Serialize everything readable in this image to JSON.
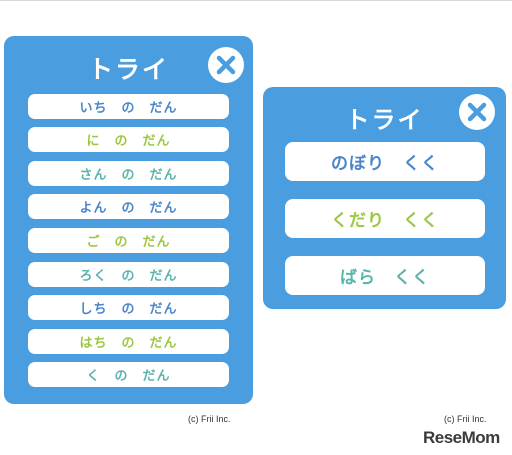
{
  "left_panel": {
    "title": "トライ",
    "buttons": [
      {
        "label": "いち　の　だん",
        "color": "#4a86c8"
      },
      {
        "label": "に　の　だん",
        "color": "#9cc741"
      },
      {
        "label": "さん　の　だん",
        "color": "#5ab4ad"
      },
      {
        "label": "よん　の　だん",
        "color": "#4a86c8"
      },
      {
        "label": "ご　の　だん",
        "color": "#9cc741"
      },
      {
        "label": "ろく　の　だん",
        "color": "#5ab4ad"
      },
      {
        "label": "しち　の　だん",
        "color": "#4a86c8"
      },
      {
        "label": "はち　の　だん",
        "color": "#9cc741"
      },
      {
        "label": "く　の　だん",
        "color": "#5ab4ad"
      }
    ],
    "copyright": "(c) Frii Inc."
  },
  "right_panel": {
    "title": "トライ",
    "buttons": [
      {
        "label": "のぼり　くく",
        "color": "#4a86c8"
      },
      {
        "label": "くだり　くく",
        "color": "#9cc741"
      },
      {
        "label": "ばら　くく",
        "color": "#5ab4ad"
      }
    ],
    "copyright": "(c) Frii Inc."
  },
  "colors": {
    "panel_bg": "#4a9ee0",
    "button_bg": "#ffffff",
    "close_icon": "#4a9ee0"
  },
  "icons": {
    "close": "close-icon"
  },
  "watermark": "ReseMom"
}
